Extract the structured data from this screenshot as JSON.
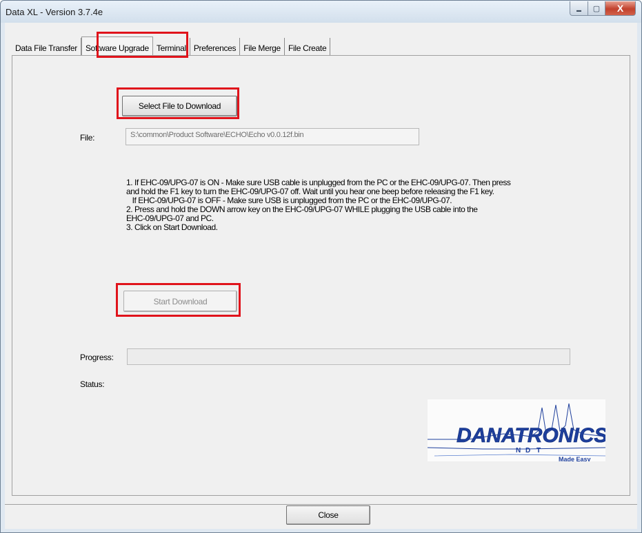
{
  "window": {
    "title": "Data XL - Version 3.7.4e",
    "controls": {
      "minimize": "▬",
      "maximize": "▢",
      "close": "X"
    }
  },
  "tabs": [
    {
      "label": "Data File Transfer",
      "active": false
    },
    {
      "label": "Software Upgrade",
      "active": true
    },
    {
      "label": "Terminal",
      "active": false
    },
    {
      "label": "Preferences",
      "active": false
    },
    {
      "label": "File Merge",
      "active": false
    },
    {
      "label": "File Create",
      "active": false
    }
  ],
  "upgrade": {
    "select_file_label": "Select File to Download",
    "file_label": "File:",
    "file_value": "S:\\common\\Product Software\\ECHO\\Echo v0.0.12f.bin",
    "instructions": [
      "1. If EHC-09/UPG-07 is ON - Make sure USB cable is unplugged from the PC or the EHC-09/UPG-07.  Then press",
      "and hold the F1 key to turn the EHC-09/UPG-07 off. Wait until you hear one beep before releasing the F1 key.",
      "   If EHC-09/UPG-07 is OFF - Make sure USB is unplugged from the PC or the EHC-09/UPG-07.",
      "2. Press and hold the DOWN arrow key on the EHC-09/UPG-07 WHILE plugging the USB cable into the",
      "EHC-09/UPG-07 and PC.",
      "3. Click on Start Download."
    ],
    "start_download_label": "Start Download",
    "progress_label": "Progress:",
    "progress_value": 0,
    "status_label": "Status:",
    "status_value": ""
  },
  "logo": {
    "brand": "DANATRONICS",
    "letters": [
      "N",
      "D",
      "T"
    ],
    "tagline": "Made Easy"
  },
  "footer": {
    "close_label": "Close"
  },
  "colors": {
    "highlight": "#e0131b",
    "logo_blue": "#1e3f9c"
  }
}
